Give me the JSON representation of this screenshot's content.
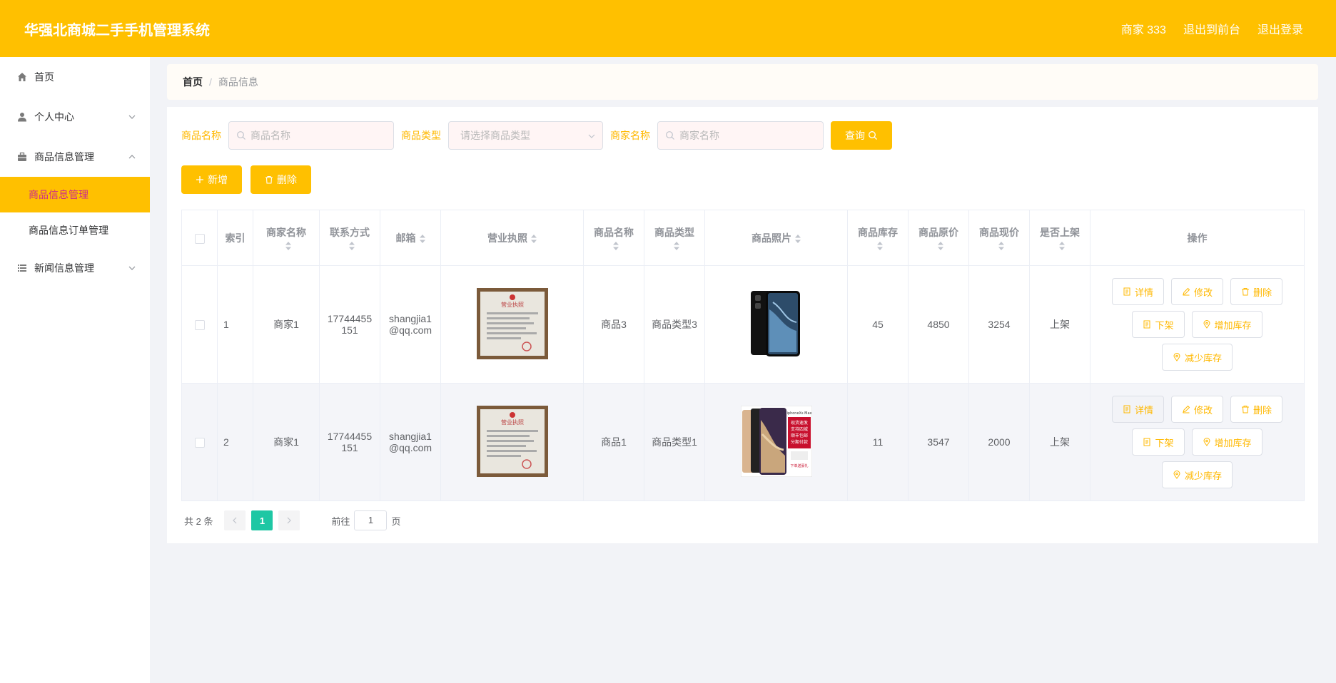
{
  "header": {
    "title": "华强北商城二手手机管理系统",
    "user": "商家 333",
    "front_link": "退出到前台",
    "logout": "退出登录"
  },
  "sidebar": {
    "home": "首页",
    "personal": "个人中心",
    "goods_mgmt": "商品信息管理",
    "goods_sub_active": "商品信息管理",
    "goods_orders": "商品信息订单管理",
    "news_mgmt": "新闻信息管理"
  },
  "breadcrumb": {
    "home": "首页",
    "sep": "/",
    "current": "商品信息"
  },
  "search": {
    "name_label": "商品名称",
    "name_placeholder": "商品名称",
    "type_label": "商品类型",
    "type_placeholder": "请选择商品类型",
    "merchant_label": "商家名称",
    "merchant_placeholder": "商家名称",
    "query_btn": "查询"
  },
  "actions": {
    "add": "新增",
    "delete": "删除"
  },
  "table": {
    "headers": {
      "index": "索引",
      "merchant": "商家名称",
      "phone": "联系方式",
      "email": "邮箱",
      "license": "营业执照",
      "goods_name": "商品名称",
      "goods_type": "商品类型",
      "photo": "商品照片",
      "stock": "商品库存",
      "orig_price": "商品原价",
      "cur_price": "商品现价",
      "on_shelf": "是否上架",
      "ops": "操作"
    },
    "rows": [
      {
        "index": "1",
        "merchant": "商家1",
        "phone": "17744455151",
        "email": "shangjia1@qq.com",
        "goods_name": "商品3",
        "goods_type": "商品类型3",
        "stock": "45",
        "orig_price": "4850",
        "cur_price": "3254",
        "on_shelf": "上架"
      },
      {
        "index": "2",
        "merchant": "商家1",
        "phone": "17744455151",
        "email": "shangjia1@qq.com",
        "goods_name": "商品1",
        "goods_type": "商品类型1",
        "stock": "11",
        "orig_price": "3547",
        "cur_price": "2000",
        "on_shelf": "上架"
      }
    ],
    "op_labels": {
      "detail": "详情",
      "edit": "修改",
      "delete": "删除",
      "offshelf": "下架",
      "add_stock": "增加库存",
      "reduce_stock": "减少库存"
    }
  },
  "pager": {
    "total": "共 2 条",
    "page": "1",
    "goto": "前往",
    "goto_value": "1",
    "page_unit": "页"
  },
  "photo_text": {
    "license_title": "营业执照",
    "phone2_brand": "iphoneXs Max",
    "phone2_promo": [
      "现货速发",
      "支持四城",
      "顺丰包邮",
      "分期付款"
    ],
    "phone2_footer": "下单送豪礼"
  },
  "colors": {
    "accent": "#ffc000",
    "accent_text": "#ffb800",
    "active_submenu_text": "#cc2a8c",
    "pager_active": "#1ec7a4"
  }
}
